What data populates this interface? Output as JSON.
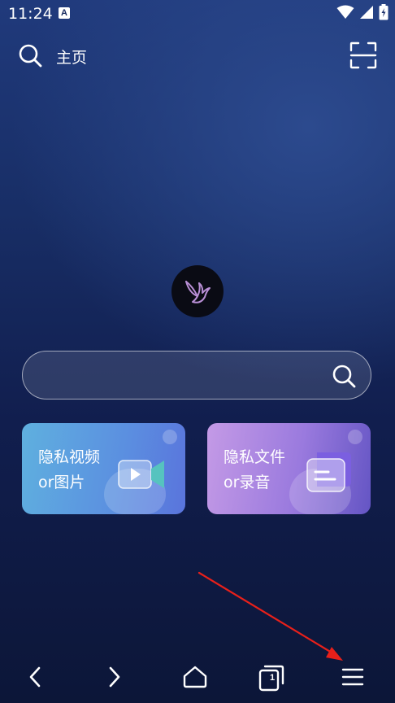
{
  "status_bar": {
    "time": "11:24",
    "notification_badge": "A",
    "icons": [
      "wifi-icon",
      "signal-icon",
      "battery-charging-icon"
    ]
  },
  "top_bar": {
    "home_label": "主页",
    "left_icon": "search-icon",
    "right_icon": "scan-icon"
  },
  "logo": {
    "icon": "bird-logo-icon",
    "accent_color": "#b98fd6"
  },
  "search": {
    "value": "",
    "placeholder": "",
    "icon": "search-icon"
  },
  "cards": [
    {
      "line1": "隐私视频",
      "line2": "or图片",
      "icon": "video-camera-icon"
    },
    {
      "line1": "隐私文件",
      "line2": "or录音",
      "icon": "folder-icon"
    }
  ],
  "bottom_nav": {
    "items": [
      "back-icon",
      "forward-icon",
      "home-icon",
      "tabs-icon",
      "menu-icon"
    ],
    "tab_count": "1"
  },
  "annotation": {
    "type": "red-arrow",
    "color": "#e8201a",
    "target": "menu-button"
  }
}
